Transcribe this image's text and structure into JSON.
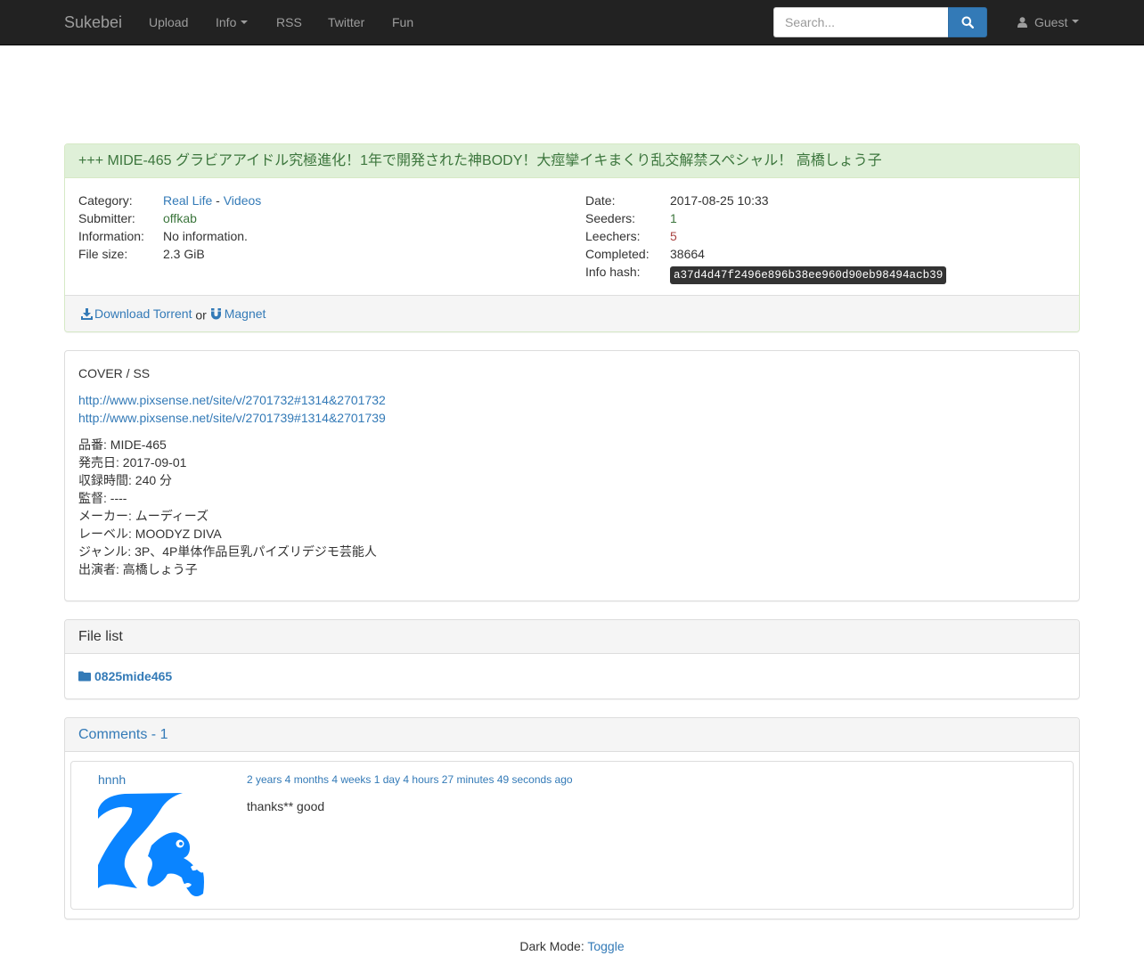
{
  "nav": {
    "brand": "Sukebei",
    "links": [
      "Upload",
      "Info",
      "RSS",
      "Twitter",
      "Fun"
    ],
    "search_placeholder": "Search...",
    "user_label": "Guest"
  },
  "torrent": {
    "title": "+++ MIDE-465 グラビアアイドル究極進化！1年で開発された神BODY！大痙攣イキまくり乱交解禁スペシャル！ 高橋しょう子",
    "labels": {
      "category": "Category:",
      "submitter": "Submitter:",
      "information": "Information:",
      "file_size": "File size:",
      "date": "Date:",
      "seeders": "Seeders:",
      "leechers": "Leechers:",
      "completed": "Completed:",
      "info_hash": "Info hash:"
    },
    "category_main": "Real Life",
    "category_sep": " - ",
    "category_sub": "Videos",
    "submitter": "offkab",
    "information": "No information.",
    "file_size": "2.3 GiB",
    "date": "2017-08-25 10:33",
    "seeders": "1",
    "leechers": "5",
    "completed": "38664",
    "info_hash": "a37d4d47f2496e896b38ee960d90eb98494acb39",
    "download_label": "Download Torrent",
    "or_text": " or ",
    "magnet_label": "Magnet"
  },
  "description": {
    "heading": "COVER / SS",
    "links": [
      "http://www.pixsense.net/site/v/2701732#1314&2701732",
      "http://www.pixsense.net/site/v/2701739#1314&2701739"
    ],
    "lines": [
      "品番: MIDE-465",
      "発売日: 2017-09-01",
      "収録時間: 240 分",
      "監督: ----",
      "メーカー: ムーディーズ",
      "レーベル: MOODYZ DIVA",
      "ジャンル: 3P、4P単体作品巨乳パイズリデジモ芸能人",
      "出演者: 高橋しょう子"
    ]
  },
  "file_list": {
    "title": "File list",
    "folder": "0825mide465"
  },
  "comments": {
    "title": "Comments - 1",
    "items": [
      {
        "user": "hnnh",
        "time": "2 years 4 months 4 weeks 1 day 4 hours 27 minutes 49 seconds ago",
        "text": "thanks** good"
      }
    ]
  },
  "footer": {
    "label": "Dark Mode: ",
    "toggle": "Toggle"
  },
  "colors": {
    "navbar_bg": "#222222",
    "link": "#337ab7",
    "success_bg": "#dff0d8",
    "success_text": "#3c763d",
    "danger_text": "#a94442",
    "avatar_blue": "#0a84ff"
  },
  "icons": [
    "search-icon",
    "user-icon",
    "download-icon",
    "magnet-icon",
    "folder-icon",
    "avatar-image"
  ]
}
